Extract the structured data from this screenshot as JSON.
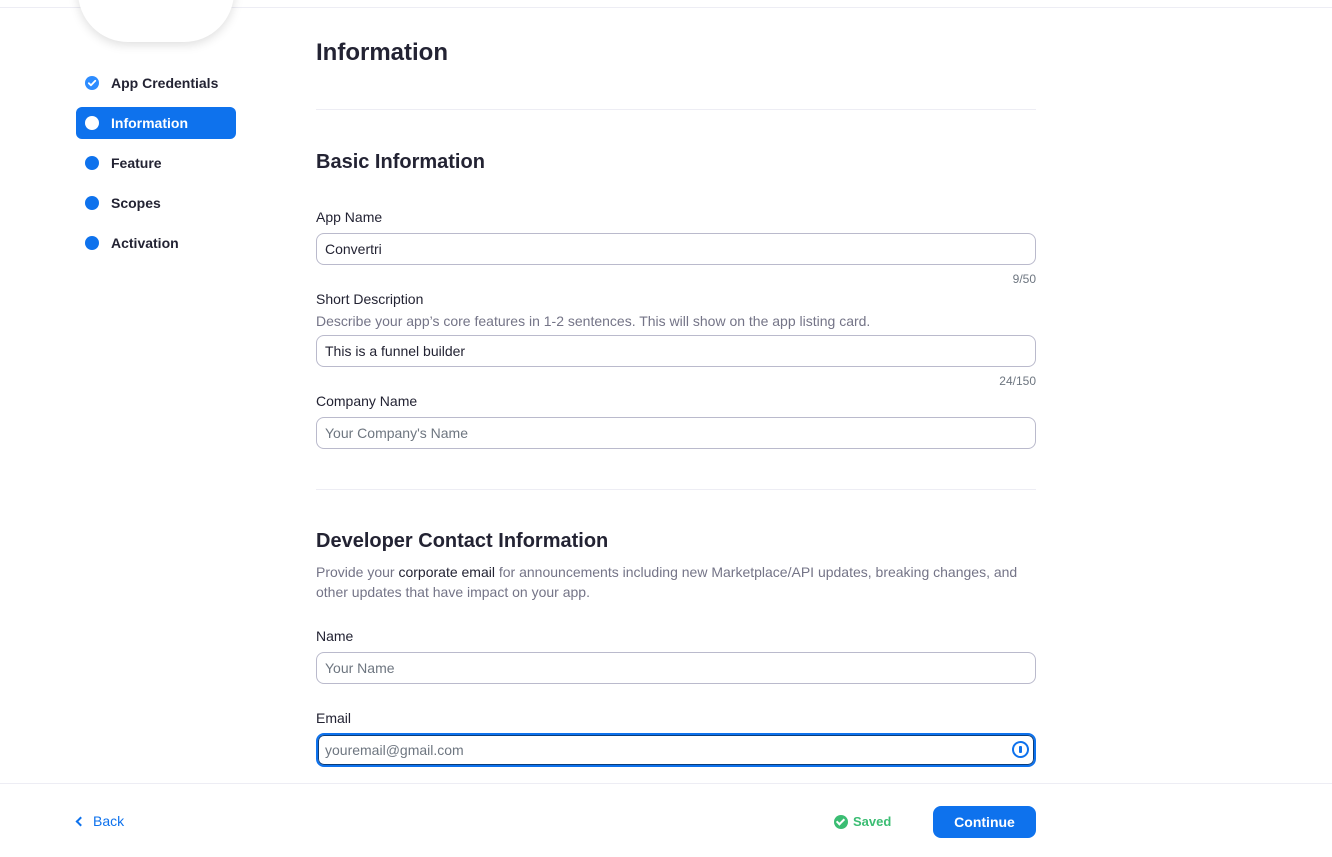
{
  "sidebar": {
    "steps": [
      {
        "label": "App Credentials",
        "state": "done"
      },
      {
        "label": "Information",
        "state": "active"
      },
      {
        "label": "Feature",
        "state": "pending"
      },
      {
        "label": "Scopes",
        "state": "pending"
      },
      {
        "label": "Activation",
        "state": "pending"
      }
    ]
  },
  "page": {
    "title": "Information"
  },
  "basic": {
    "section_title": "Basic Information",
    "app_name": {
      "label": "App Name",
      "value": "Convertri",
      "counter": "9/50"
    },
    "short_description": {
      "label": "Short Description",
      "help": "Describe your app’s core features in 1-2 sentences. This will show on the app listing card.",
      "value": "This is a funnel builder",
      "counter": "24/150"
    },
    "company_name": {
      "label": "Company Name",
      "placeholder": "Your Company's Name"
    }
  },
  "contact": {
    "section_title": "Developer Contact Information",
    "help_pre": "Provide your ",
    "help_strong": "corporate email",
    "help_post": " for announcements including new Marketplace/API updates, breaking changes, and other updates that have impact on your app.",
    "name": {
      "label": "Name",
      "placeholder": "Your Name"
    },
    "email": {
      "label": "Email",
      "placeholder": "youremail@gmail.com"
    }
  },
  "footer": {
    "back_label": "Back",
    "saved_label": "Saved",
    "continue_label": "Continue"
  },
  "colors": {
    "accent": "#0e72ed",
    "success": "#3bbd73",
    "text": "#232333",
    "muted": "#747487"
  },
  "icons": {
    "done_step": "check-circle-icon",
    "back": "chevron-left-icon",
    "saved": "check-circle-icon",
    "password_manager": "password-manager-icon"
  }
}
